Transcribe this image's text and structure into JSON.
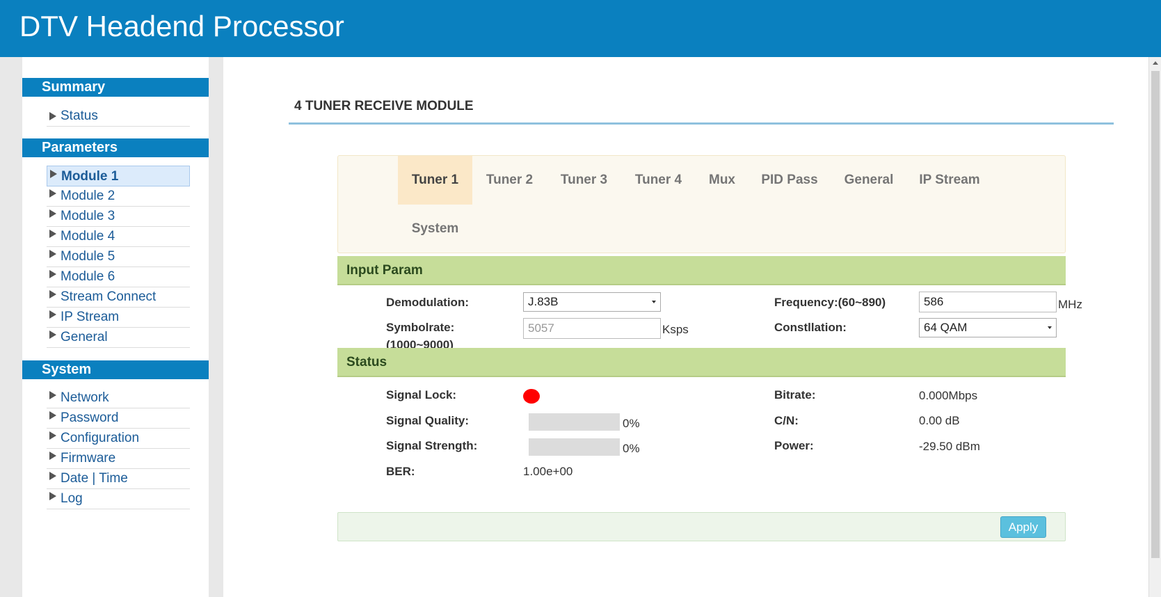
{
  "app": {
    "title": "DTV Headend Processor"
  },
  "sidebar": {
    "summary_header": "Summary",
    "summary_items": [
      {
        "label": "Status"
      }
    ],
    "parameters_header": "Parameters",
    "parameters_items": [
      {
        "label": "Module 1",
        "active": true
      },
      {
        "label": "Module 2"
      },
      {
        "label": "Module 3"
      },
      {
        "label": "Module 4"
      },
      {
        "label": "Module 5"
      },
      {
        "label": "Module 6"
      },
      {
        "label": "Stream Connect"
      },
      {
        "label": "IP Stream"
      },
      {
        "label": "General"
      }
    ],
    "system_header": "System",
    "system_items": [
      {
        "label": "Network"
      },
      {
        "label": "Password"
      },
      {
        "label": "Configuration"
      },
      {
        "label": "Firmware"
      },
      {
        "label": "Date | Time"
      },
      {
        "label": "Log"
      }
    ]
  },
  "main": {
    "page_title": "4 TUNER RECEIVE MODULE",
    "tabs": [
      {
        "label": "Tuner 1",
        "active": true
      },
      {
        "label": "Tuner 2"
      },
      {
        "label": "Tuner 3"
      },
      {
        "label": "Tuner 4"
      },
      {
        "label": "Mux"
      },
      {
        "label": "PID Pass"
      },
      {
        "label": "General"
      },
      {
        "label": "IP Stream"
      },
      {
        "label": "System"
      }
    ],
    "input_param": {
      "header": "Input Param",
      "demodulation_label": "Demodulation:",
      "demodulation_value": "J.83B",
      "frequency_label": "Frequency:(60~890)",
      "frequency_value": "586",
      "frequency_unit": "MHz",
      "symbolrate_label": "Symbolrate:",
      "symbolrate_range": "(1000~9000)",
      "symbolrate_value": "5057",
      "symbolrate_unit": "Ksps",
      "constellation_label": "Constllation:",
      "constellation_value": "64 QAM"
    },
    "status": {
      "header": "Status",
      "signal_lock_label": "Signal Lock:",
      "signal_lock_color": "#ff0000",
      "signal_quality_label": "Signal Quality:",
      "signal_quality_value": "0%",
      "signal_quality_fraction": 0,
      "signal_strength_label": "Signal Strength:",
      "signal_strength_value": "0%",
      "signal_strength_fraction": 0,
      "ber_label": "BER:",
      "ber_value": "1.00e+00",
      "bitrate_label": "Bitrate:",
      "bitrate_value": "0.000Mbps",
      "cn_label": "C/N:",
      "cn_value": "0.00 dB",
      "power_label": "Power:",
      "power_value": "-29.50 dBm"
    },
    "apply_label": "Apply"
  }
}
